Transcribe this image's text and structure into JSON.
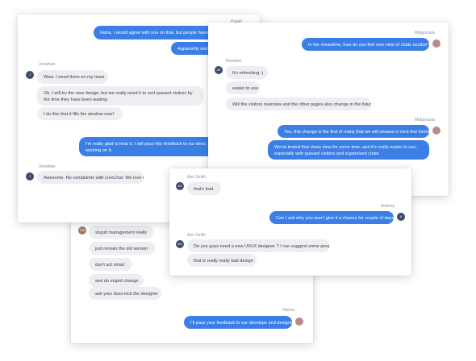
{
  "card_d": {
    "messages": [
      "stupid management really",
      "just remain the old version",
      "don't act smart",
      "and do stupid change",
      "ask your boss kick the designer"
    ],
    "avatar_initials": "CW",
    "agent_name": "Hanna",
    "agent_message": "I'll pass your feedback to our develops and designer"
  },
  "card_a": {
    "agent_name": "Pawel",
    "agent_msg_1": "Haha, I would agree with you on that, but people have dif",
    "agent_msg_2": "Apparently som",
    "visitor_name": "Jonathan",
    "avatar_initials": "J",
    "visitor_msgs": [
      "Wow. I need them on my team.",
      "Ok. I will try the new design, but we really need it to sort queued visitors by the time they have been waiting.",
      "I do like that it fills the window now!"
    ],
    "agent_msg_3": "I'm really glad to hear it. I will pass this feedback to our devs, but I are already working on it.",
    "visitor_name_2": "Jonathan",
    "visitor_msg_4": "Awesome. No complaints with LiveChat. We love it."
  },
  "card_b": {
    "agent_name": "Malgorzata",
    "agent_msg_1": "In the meantime, how do you find new view of chats section? :)",
    "visitor_name": "Rembert",
    "avatar_initials": "JR",
    "visitor_msgs": [
      "It's refreshing :)",
      "easier to use",
      "Will the visitors overview and the other pages also change in the future?"
    ],
    "agent_name_2": "Malgorzata",
    "agent_msg_2": "Yes, this change is the first of many that we will release in next few months",
    "agent_msg_3": "We've tested that chats view for some time, and it's really easier to use, especially with queued visitors and supervised chats"
  },
  "card_c": {
    "visitor_name": "Ann Smith",
    "avatar_initials": "AS",
    "visitor_msg_1": "that's bad.",
    "agent_name": "Andrzej",
    "agent_avatar": "A",
    "agent_msg": "Can I ask why you won't give it a chance for couple of days?",
    "visitor_name_2": "Ann Smith",
    "avatar_initials_2": "AS",
    "visitor_msg_2": "Do you guys need a new UI/UX designer ? I can suggest some people",
    "visitor_msg_3": "that is really really bad design"
  }
}
